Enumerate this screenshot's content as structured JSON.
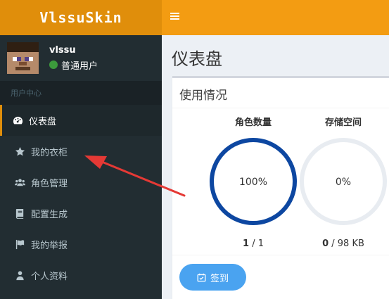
{
  "app": {
    "logo": "VlssuSkin"
  },
  "user": {
    "name": "vlssu",
    "status": "普通用户"
  },
  "sidebar": {
    "section_header": "用户中心",
    "items": [
      {
        "label": "仪表盘",
        "icon": "dashboard-icon",
        "active": true
      },
      {
        "label": "我的衣柜",
        "icon": "star-icon"
      },
      {
        "label": "角色管理",
        "icon": "users-icon"
      },
      {
        "label": "配置生成",
        "icon": "book-icon"
      },
      {
        "label": "我的举报",
        "icon": "flag-icon"
      },
      {
        "label": "个人资料",
        "icon": "user-icon"
      }
    ]
  },
  "page": {
    "title": "仪表盘"
  },
  "usage": {
    "title": "使用情况",
    "stats": [
      {
        "label": "角色数量",
        "percent_text": "100%",
        "fraction": 1.0,
        "used": "1",
        "total": " / 1",
        "color": "#0d47a1"
      },
      {
        "label": "存储空间",
        "percent_text": "0%",
        "fraction": 0.0,
        "used": "0",
        "total": " / 98 KB",
        "color": "#0d47a1"
      }
    ],
    "checkin_label": "签到"
  },
  "colors": {
    "brand": "#f39c12",
    "brand_dark": "#e08e0b",
    "sidebar": "#222d32",
    "button": "#4aa3f0",
    "annotation": "#e53935"
  }
}
